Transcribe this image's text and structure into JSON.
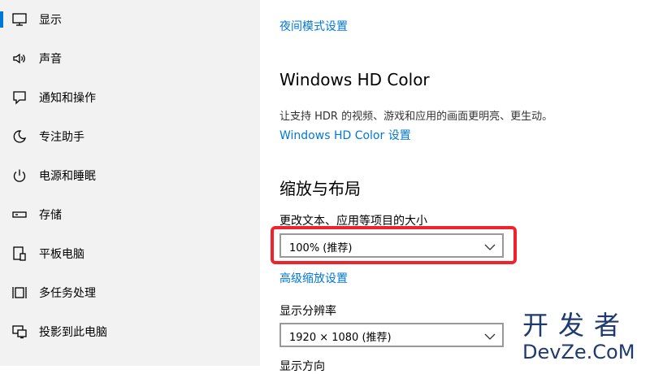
{
  "sidebar": {
    "items": [
      {
        "label": "显示",
        "icon": "monitor-icon",
        "active": true
      },
      {
        "label": "声音",
        "icon": "speaker-icon"
      },
      {
        "label": "通知和操作",
        "icon": "notification-icon"
      },
      {
        "label": "专注助手",
        "icon": "moon-icon"
      },
      {
        "label": "电源和睡眠",
        "icon": "power-icon"
      },
      {
        "label": "存储",
        "icon": "storage-icon"
      },
      {
        "label": "平板电脑",
        "icon": "tablet-icon"
      },
      {
        "label": "多任务处理",
        "icon": "multitask-icon"
      },
      {
        "label": "投影到此电脑",
        "icon": "projection-icon"
      }
    ]
  },
  "main": {
    "night_mode_link": "夜间模式设置",
    "hd_color": {
      "title": "Windows HD Color",
      "description": "让支持 HDR 的视频、游戏和应用的画面更明亮、更生动。",
      "link": "Windows HD Color 设置"
    },
    "scale_layout": {
      "title": "缩放与布局",
      "scale_label": "更改文本、应用等项目的大小",
      "scale_value": "100% (推荐)",
      "advanced_link": "高级缩放设置",
      "resolution_label": "显示分辨率",
      "resolution_value": "1920 × 1080 (推荐)",
      "orientation_label": "显示方向"
    }
  },
  "watermark": {
    "top": "开发者",
    "bottom": "DevZe.CoM"
  },
  "colors": {
    "accent": "#0078d7",
    "highlight": "#f0232d"
  }
}
